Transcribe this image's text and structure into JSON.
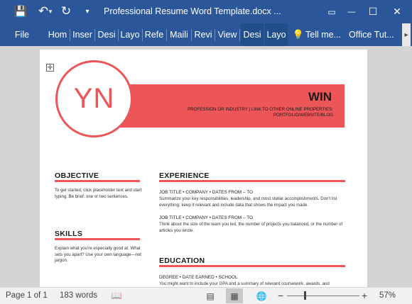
{
  "titlebar": {
    "save_icon": "💾",
    "undo_icon": "↶",
    "undo_dropdown_icon": "▾",
    "redo_icon": "↻",
    "customize_icon": "▾",
    "title": "Professional Resume Word Template.docx ...",
    "ribbon_display_icon": "▭",
    "minimize_icon": "—",
    "maximize_icon": "☐",
    "close_icon": "✕"
  },
  "ribbon": {
    "tabs": [
      "File",
      "Hom",
      "Inser",
      "Desi",
      "Layo",
      "Refe",
      "Maili",
      "Revi",
      "View",
      "Desi",
      "Layo"
    ],
    "tell_me_icon": "💡",
    "tell_me": "Tell me...",
    "account": "Office Tut...",
    "scroll_icon": "▸"
  },
  "resume": {
    "move_handle_icon": "✛",
    "initials": "YN",
    "name": "WIN",
    "profession_line": "PROFESSION OR INDUSTRY | LINK TO OTHER ONLINE PROPERTIES:",
    "links_line": "PORTFOLIO/WEBSITE/BLOG",
    "objective_heading": "OBJECTIVE",
    "objective_text": "To get started, click placeholder text and start typing. Be brief: one or two sentences.",
    "skills_heading": "SKILLS",
    "skills_text": "Explain what you're especially good at. What sets you apart? Use your own language—not jargon.",
    "experience_heading": "EXPERIENCE",
    "job1_title": "JOB TITLE • COMPANY • DATES FROM – TO",
    "job1_text": "Summarize your key responsibilities, leadership, and most stellar accomplishments. Don't list everything; keep it relevant and include data that shows the impact you made.",
    "job2_title": "JOB TITLE • COMPANY • DATES FROM – TO",
    "job2_text": "Think about the size of the team you led, the number of projects you balanced, or the number of articles you wrote.",
    "education_heading": "EDUCATION",
    "edu_title": "DEGREE • DATE EARNED • SCHOOL",
    "edu_text": "You might want to include your GPA and a summary of relevant coursework, awards, and"
  },
  "statusbar": {
    "page": "Page 1 of 1",
    "words": "183 words",
    "proofing_icon": "📖",
    "read_mode_icon": "▤",
    "print_layout_icon": "▦",
    "web_layout_icon": "🌐",
    "zoom_out": "−",
    "zoom_in": "+",
    "zoom_level": "57%"
  },
  "colors": {
    "accent": "#ec5659",
    "word_blue": "#2b579a"
  },
  "zoom": {
    "percent": 57
  }
}
